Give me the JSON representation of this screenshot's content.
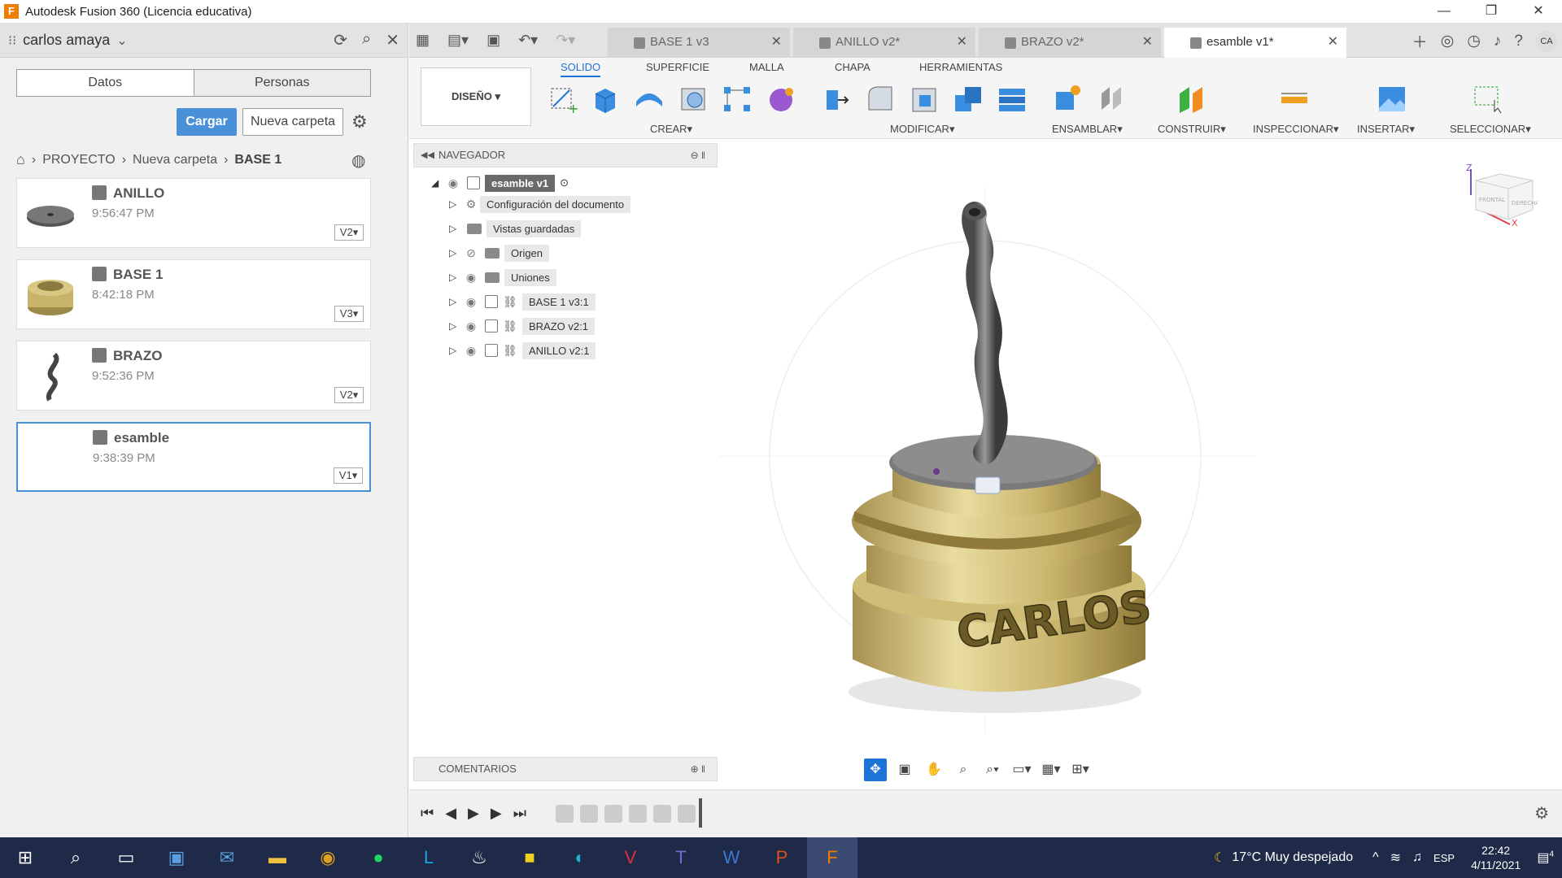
{
  "window": {
    "title": "Autodesk Fusion 360 (Licencia educativa)",
    "app_icon": "F"
  },
  "datapanel": {
    "user": "carlos amaya",
    "tab_data": "Datos",
    "tab_people": "Personas",
    "upload": "Cargar",
    "new_folder": "Nueva carpeta",
    "breadcrumb": [
      "PROYECTO",
      "Nueva carpeta",
      "BASE 1"
    ],
    "files": [
      {
        "name": "ANILLO",
        "time": "9:56:47 PM",
        "version": "V2"
      },
      {
        "name": "BASE 1",
        "time": "8:42:18 PM",
        "version": "V3"
      },
      {
        "name": "BRAZO",
        "time": "9:52:36 PM",
        "version": "V2"
      },
      {
        "name": "esamble",
        "time": "9:38:39 PM",
        "version": "V1"
      }
    ]
  },
  "doctabs": [
    {
      "label": "BASE 1 v3"
    },
    {
      "label": "ANILLO v2*"
    },
    {
      "label": "BRAZO v2*"
    },
    {
      "label": "esamble v1*"
    }
  ],
  "avatar": "CA",
  "ribbon": {
    "workspace": "DISEÑO",
    "tabs": [
      "SOLIDO",
      "SUPERFICIE",
      "MALLA",
      "CHAPA",
      "HERRAMIENTAS"
    ],
    "groups": [
      "CREAR",
      "MODIFICAR",
      "ENSAMBLAR",
      "CONSTRUIR",
      "INSPECCIONAR",
      "INSERTAR",
      "SELECCIONAR"
    ]
  },
  "navigator": {
    "title": "NAVEGADOR",
    "root": "esamble v1",
    "nodes": [
      "Configuración del documento",
      "Vistas guardadas",
      "Origen",
      "Uniones",
      "BASE 1 v3:1",
      "BRAZO v2:1",
      "ANILLO v2:1"
    ]
  },
  "model": {
    "engraving": "CARLOS"
  },
  "viewcube": {
    "z": "Z",
    "x": "X",
    "face_front": "FRONTAL",
    "face_right": "DERECHA"
  },
  "comments": {
    "title": "COMENTARIOS"
  },
  "taskbar": {
    "weather": "17°C  Muy despejado",
    "lang": "ESP",
    "time": "22:42",
    "date": "4/11/2021",
    "notifications": "4"
  }
}
